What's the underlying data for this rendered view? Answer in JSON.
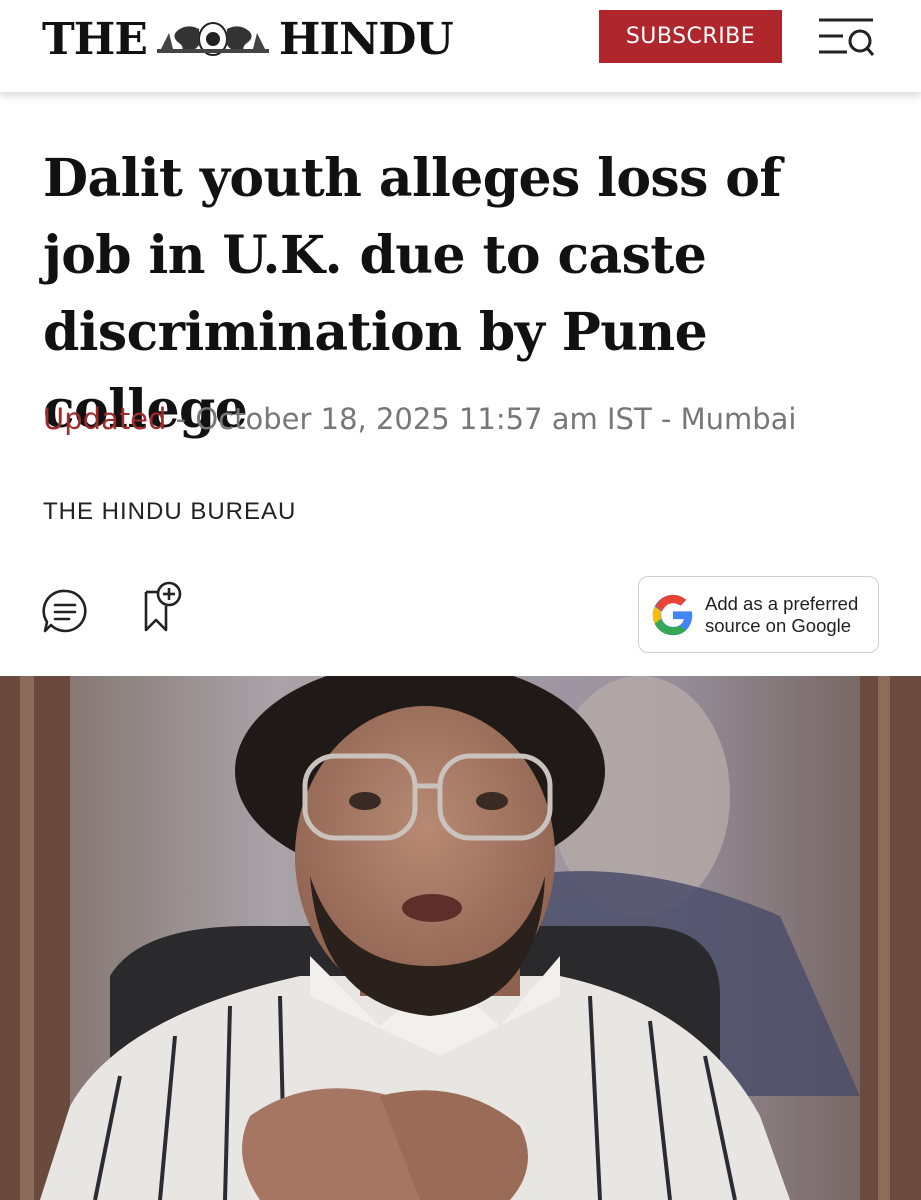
{
  "header": {
    "logo": {
      "left": "THE",
      "right": "HINDU",
      "crest_icon": "crest-emblem-icon"
    },
    "subscribe_label": "SUBSCRIBE",
    "menu_icon": "menu-search-icon"
  },
  "article": {
    "headline": "Dalit youth alleges loss of job in U.K. due to caste discrimination by Pune college",
    "meta": {
      "updated_label": "Updated",
      "separator": " - ",
      "datetime": "October 18, 2025 11:57 am IST",
      "location": "Mumbai"
    },
    "byline": "THE HINDU BUREAU",
    "actions": {
      "comment_icon": "comment-icon",
      "bookmark_icon": "bookmark-add-icon",
      "google_preferred": {
        "icon": "google-g-icon",
        "line1": "Add as a preferred",
        "line2": "source on Google"
      }
    },
    "hero_image": {
      "description_icon": "photo-man-with-glasses-striped-shirt"
    }
  },
  "colors": {
    "brand_red": "#b0262d",
    "updated_red": "#9e2a2b",
    "meta_grey": "#777777"
  }
}
